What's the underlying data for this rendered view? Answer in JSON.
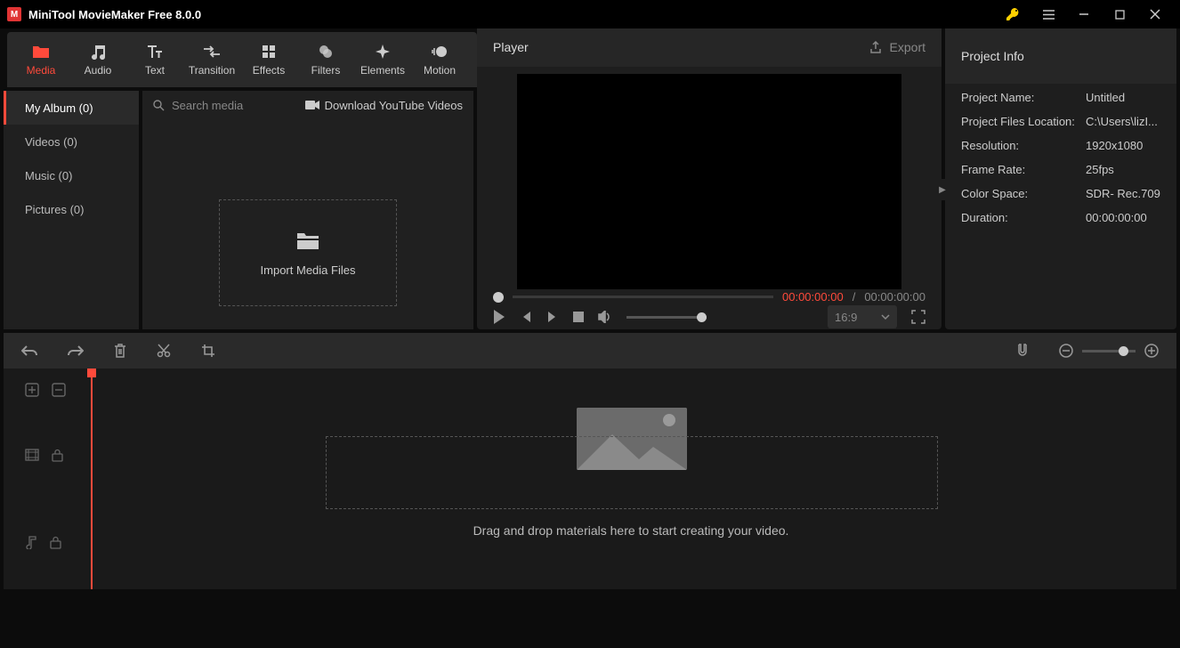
{
  "titlebar": {
    "title": "MiniTool MovieMaker Free 8.0.0"
  },
  "toolbar": {
    "media": "Media",
    "audio": "Audio",
    "text": "Text",
    "transition": "Transition",
    "effects": "Effects",
    "filters": "Filters",
    "elements": "Elements",
    "motion": "Motion"
  },
  "sidebar": {
    "my_album": "My Album (0)",
    "videos": "Videos (0)",
    "music": "Music (0)",
    "pictures": "Pictures (0)"
  },
  "media_panel": {
    "search_placeholder": "Search media",
    "download_yt": "Download YouTube Videos",
    "import_label": "Import Media Files"
  },
  "player": {
    "title": "Player",
    "export": "Export",
    "current_time": "00:00:00:00",
    "separator": " / ",
    "total_time": "00:00:00:00",
    "aspect": "16:9"
  },
  "project_info": {
    "title": "Project Info",
    "name_k": "Project Name:",
    "name_v": "Untitled",
    "loc_k": "Project Files Location:",
    "loc_v": "C:\\Users\\lizI...",
    "res_k": "Resolution:",
    "res_v": "1920x1080",
    "fps_k": "Frame Rate:",
    "fps_v": "25fps",
    "cs_k": "Color Space:",
    "cs_v": "SDR- Rec.709",
    "dur_k": "Duration:",
    "dur_v": "00:00:00:00"
  },
  "timeline": {
    "drop_hint": "Drag and drop materials here to start creating your video."
  }
}
